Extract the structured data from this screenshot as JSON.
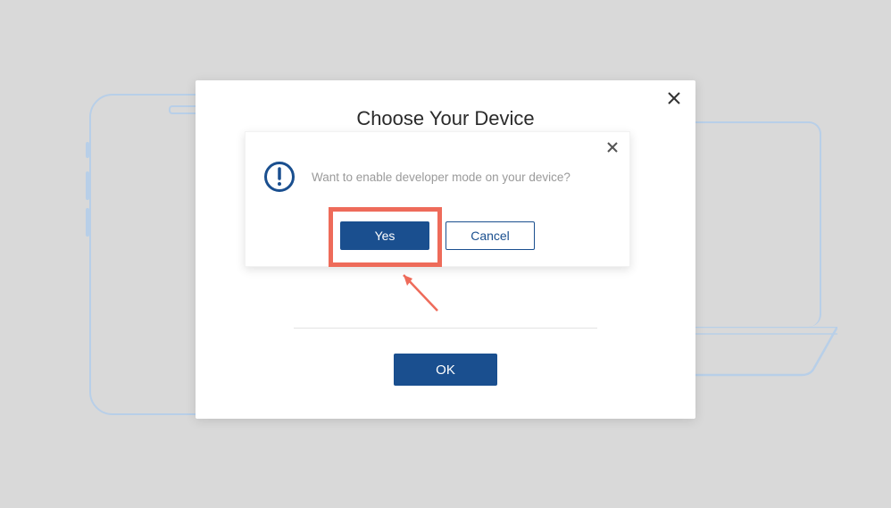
{
  "outer_modal": {
    "title": "Choose Your Device",
    "ok_label": "OK"
  },
  "inner_modal": {
    "message": "Want to enable developer mode on your device?",
    "yes_label": "Yes",
    "cancel_label": "Cancel"
  },
  "icons": {
    "info": "exclamation-circle",
    "close": "close"
  },
  "annotation": {
    "highlight_color": "#ee6b5a"
  }
}
